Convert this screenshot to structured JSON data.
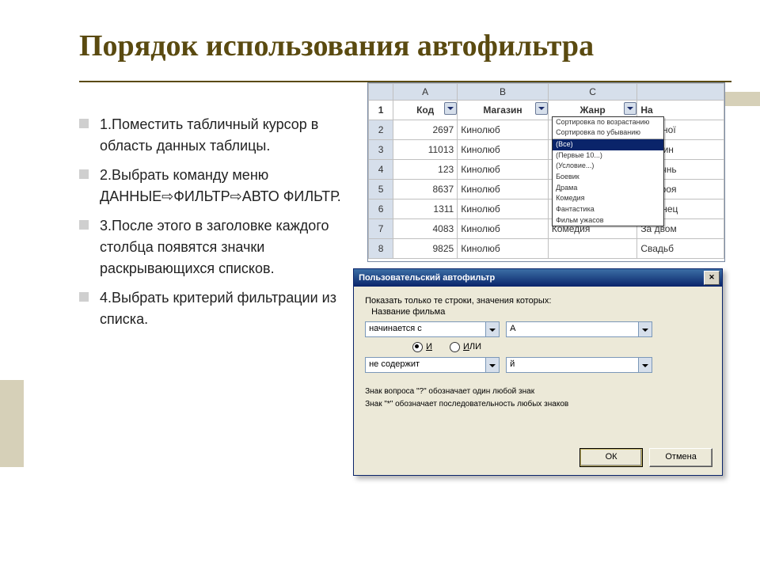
{
  "title": "Порядок использования автофильтра",
  "bullets": [
    "1.Поместить табличный курсор в область данных таблицы.",
    "2.Выбрать команду меню ДАННЫЕ⇨ФИЛЬТР⇨АВТО ФИЛЬТР.",
    "3.После этого в заголовке каждого столбца появятся значки раскрывающихся списков.",
    "4.Выбрать критерий фильтрации из списка."
  ],
  "sheet": {
    "col_letters": [
      "",
      "A",
      "B",
      "C",
      ""
    ],
    "headers": [
      "Код",
      "Магазин",
      "Жанр",
      "На"
    ],
    "rows": [
      {
        "n": "2",
        "code": "2697",
        "store": "Кинолюб",
        "genre": "",
        "name": "Двойної"
      },
      {
        "n": "3",
        "code": "11013",
        "store": "Кинолюб",
        "genre": "",
        "name": "Термин"
      },
      {
        "n": "4",
        "code": "123",
        "store": "Кинолюб",
        "genre": "",
        "name": "Аптечнь"
      },
      {
        "n": "5",
        "code": "8637",
        "store": "Кинолюб",
        "genre": "",
        "name": "Под роя"
      },
      {
        "n": "6",
        "code": "1311",
        "store": "Кинолюб",
        "genre": "",
        "name": "Близнец"
      },
      {
        "n": "7",
        "code": "4083",
        "store": "Кинолюб",
        "genre": "Комедия",
        "name": "За двом"
      },
      {
        "n": "8",
        "code": "9825",
        "store": "Кинолюб",
        "genre": "",
        "name": "Свадьб"
      }
    ],
    "filter_menu": [
      "Сортировка по возрастанию",
      "Сортировка по убыванию",
      "(Все)",
      "(Первые 10...)",
      "(Условие...)",
      "Боевик",
      "Драма",
      "Комедия",
      "Фантастика",
      "Фильм ужасов"
    ],
    "filter_selected_index": 2
  },
  "dialog": {
    "title": "Пользовательский автофильтр",
    "intro": "Показать только те строки, значения которых:",
    "field_label": "Название фильма",
    "cond1_op": "начинается с",
    "cond1_val": "А",
    "radio_and": "И",
    "radio_or": "ИЛИ",
    "cond2_op": "не содержит",
    "cond2_val": "й",
    "hint1": "Знак вопроса \"?\" обозначает один любой знак",
    "hint2": "Знак \"*\" обозначает последовательность любых знаков",
    "ok": "ОК",
    "cancel": "Отмена"
  }
}
